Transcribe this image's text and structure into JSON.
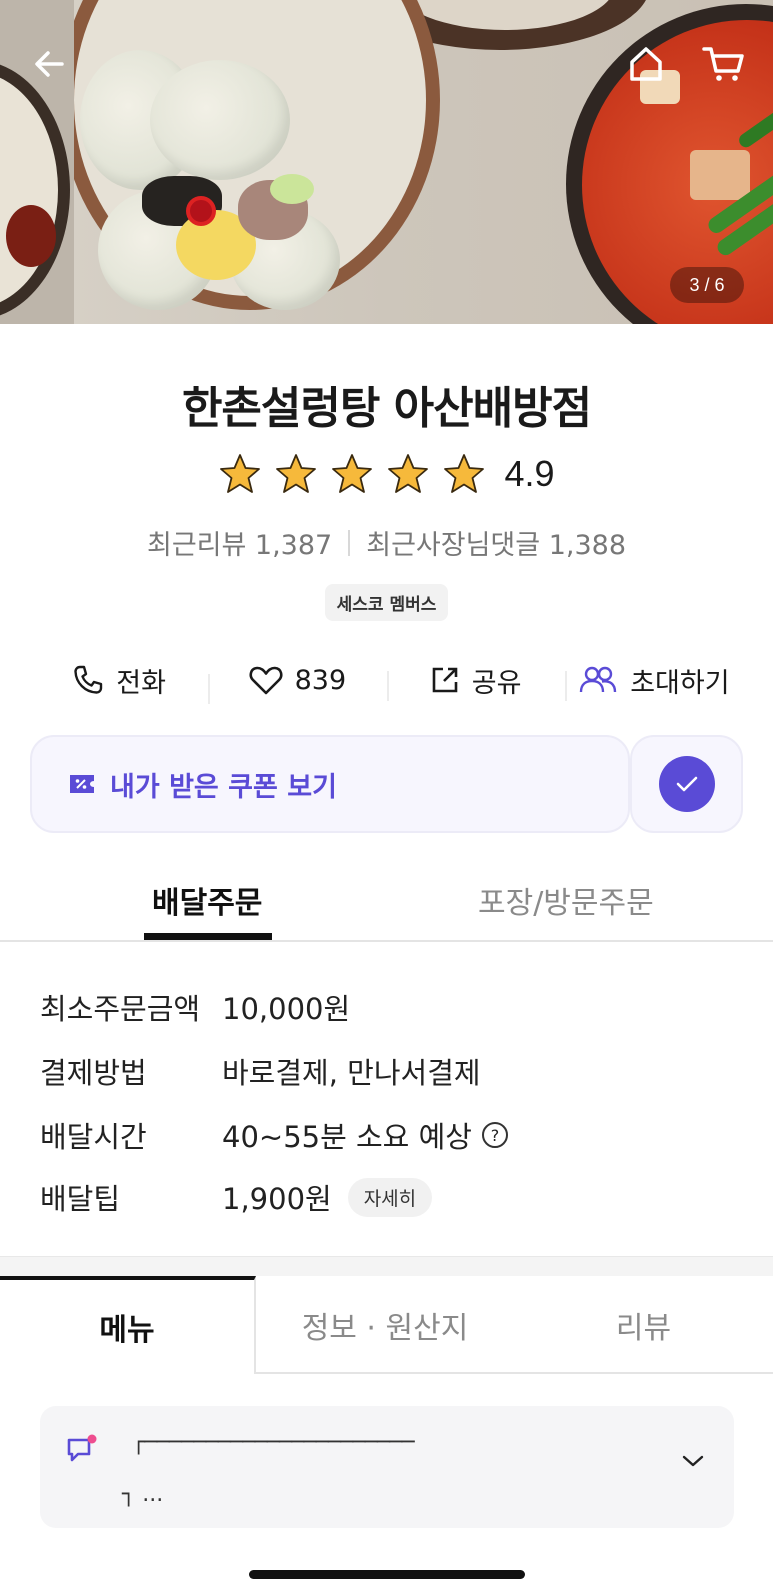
{
  "hero": {
    "pager": "3 / 6",
    "icons": {
      "back": "arrow-left-icon",
      "home": "home-icon",
      "cart": "cart-icon"
    }
  },
  "store": {
    "name": "한촌설렁탕 아산배방점",
    "rating_value": "4.9",
    "rating_stars": 5,
    "recent_reviews": "최근리뷰 1,387",
    "recent_owner_replies": "최근사장님댓글 1,388",
    "member_badge": "세스코 멤버스"
  },
  "actions": [
    {
      "icon": "phone-icon",
      "label": "전화"
    },
    {
      "icon": "heart-icon",
      "label": "839"
    },
    {
      "icon": "share-icon",
      "label": "공유"
    },
    {
      "icon": "people-icon",
      "label": "초대하기"
    }
  ],
  "coupon": {
    "label": "내가 받은 쿠폰 보기",
    "accent": "#5a4bd6"
  },
  "order_tabs": {
    "delivery": "배달주문",
    "pickup": "포장/방문주문",
    "active": "delivery"
  },
  "delivery_info": {
    "min_order_label": "최소주문금액",
    "min_order_value": "10,000원",
    "payment_label": "결제방법",
    "payment_value": "바로결제, 만나서결제",
    "time_label": "배달시간",
    "time_value": "40~55분 소요 예상",
    "tip_label": "배달팁",
    "tip_value": "1,900원",
    "tip_detail": "자세히"
  },
  "bottom_tabs": {
    "menu": "메뉴",
    "info": "정보 · 원산지",
    "review": "리뷰",
    "active": "menu"
  },
  "notice": {
    "line1": "┌──────────────────────",
    "line2": "┐ ..."
  }
}
